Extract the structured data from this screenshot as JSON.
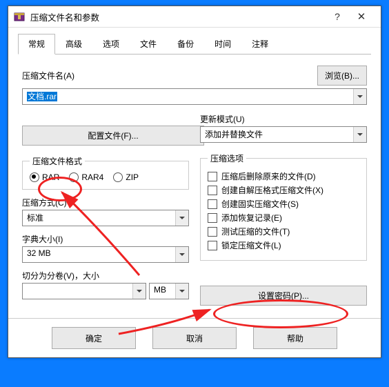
{
  "window": {
    "title": "压缩文件名和参数"
  },
  "tabs": {
    "list": [
      "常规",
      "高级",
      "选项",
      "文件",
      "备份",
      "时间",
      "注释"
    ],
    "active": 0
  },
  "archiveName": {
    "label": "压缩文件名(A)",
    "value": "文档.rar"
  },
  "browseBtn": "浏览(B)...",
  "updateMode": {
    "label": "更新模式(U)",
    "value": "添加并替换文件"
  },
  "profilesBtn": "配置文件(F)...",
  "formatGroup": {
    "legend": "压缩文件格式",
    "options": [
      "RAR",
      "RAR4",
      "ZIP"
    ],
    "selected": 0
  },
  "methodLabel": "压缩方式(C)",
  "methodValue": "标准",
  "dictLabel": "字典大小(I)",
  "dictValue": "32 MB",
  "splitLabel": "切分为分卷(V)，大小",
  "splitValue": "",
  "splitUnit": "MB",
  "optionsGroup": {
    "legend": "压缩选项",
    "items": [
      "压缩后删除原来的文件(D)",
      "创建自解压格式压缩文件(X)",
      "创建固实压缩文件(S)",
      "添加恢复记录(E)",
      "测试压缩的文件(T)",
      "锁定压缩文件(L)"
    ]
  },
  "setPasswordBtn": "设置密码(P)...",
  "footer": {
    "ok": "确定",
    "cancel": "取消",
    "help": "帮助"
  }
}
